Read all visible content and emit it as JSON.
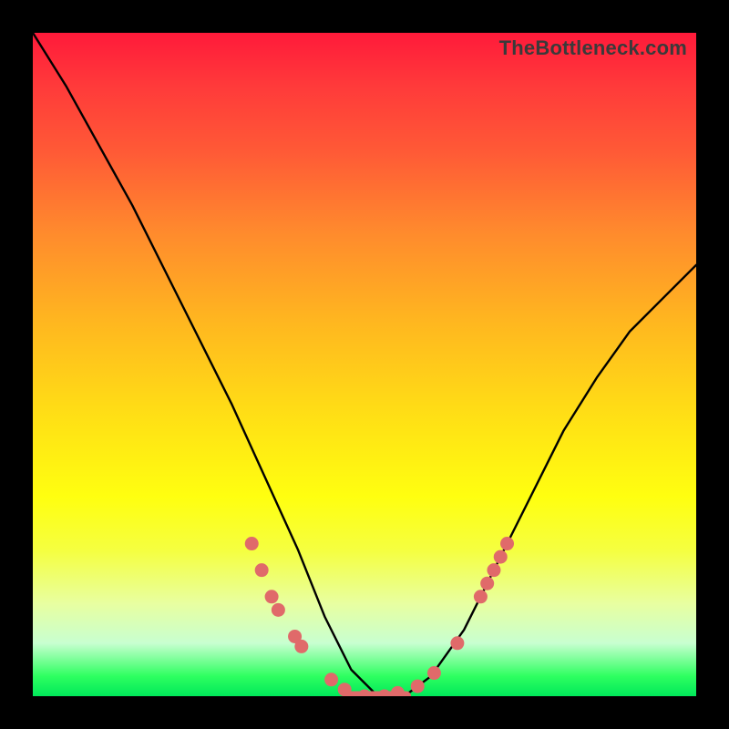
{
  "watermark": "TheBottleneck.com",
  "chart_data": {
    "type": "line",
    "title": "",
    "xlabel": "",
    "ylabel": "",
    "xlim": [
      0,
      100
    ],
    "ylim": [
      0,
      100
    ],
    "grid": false,
    "legend": false,
    "series": [
      {
        "name": "curve",
        "x": [
          0,
          5,
          10,
          15,
          20,
          25,
          30,
          35,
          40,
          44,
          48,
          52,
          56,
          60,
          65,
          70,
          75,
          80,
          85,
          90,
          95,
          100
        ],
        "y": [
          100,
          92,
          83,
          74,
          64,
          54,
          44,
          33,
          22,
          12,
          4,
          0,
          0,
          3,
          10,
          20,
          30,
          40,
          48,
          55,
          60,
          65
        ]
      }
    ],
    "markers": [
      {
        "x": 33,
        "y": 23
      },
      {
        "x": 34.5,
        "y": 19
      },
      {
        "x": 36,
        "y": 15
      },
      {
        "x": 37,
        "y": 13
      },
      {
        "x": 39.5,
        "y": 9
      },
      {
        "x": 40.5,
        "y": 7.5
      },
      {
        "x": 45,
        "y": 2.5
      },
      {
        "x": 47,
        "y": 1
      },
      {
        "x": 50,
        "y": 0
      },
      {
        "x": 53,
        "y": 0
      },
      {
        "x": 55,
        "y": 0.5
      },
      {
        "x": 58,
        "y": 1.5
      },
      {
        "x": 60.5,
        "y": 3.5
      },
      {
        "x": 64,
        "y": 8
      },
      {
        "x": 67.5,
        "y": 15
      },
      {
        "x": 68.5,
        "y": 17
      },
      {
        "x": 69.5,
        "y": 19
      },
      {
        "x": 70.5,
        "y": 21
      },
      {
        "x": 71.5,
        "y": 23
      }
    ],
    "gradient_stops": [
      {
        "pos": 0.0,
        "color": "#ff1a3a"
      },
      {
        "pos": 0.5,
        "color": "#ffe015"
      },
      {
        "pos": 0.95,
        "color": "#80ffb0"
      },
      {
        "pos": 1.0,
        "color": "#00e85a"
      }
    ]
  }
}
